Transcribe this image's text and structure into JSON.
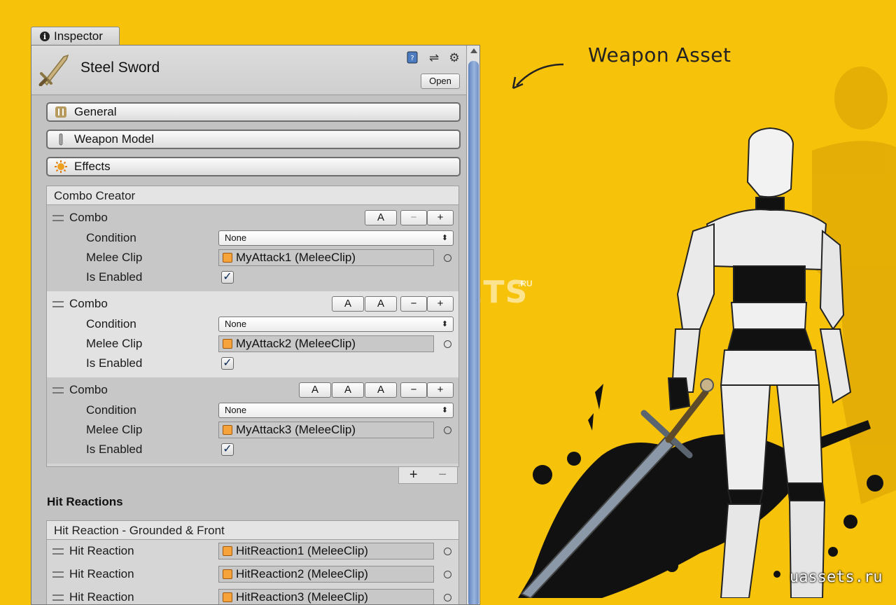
{
  "inspector": {
    "tab_label": "Inspector",
    "asset_title": "Steel Sword",
    "open_label": "Open",
    "sections": [
      {
        "label": "General",
        "icon": "general-icon"
      },
      {
        "label": "Weapon Model",
        "icon": "weapon-model-icon"
      },
      {
        "label": "Effects",
        "icon": "effects-icon"
      }
    ],
    "combo_creator": {
      "header": "Combo Creator",
      "combos": [
        {
          "label": "Combo",
          "buttons": [
            "A"
          ],
          "condition_label": "Condition",
          "condition_value": "None",
          "clip_label": "Melee Clip",
          "clip_value": "MyAttack1 (MeleeClip)",
          "enabled_label": "Is Enabled",
          "enabled": true
        },
        {
          "label": "Combo",
          "buttons": [
            "A",
            "A"
          ],
          "condition_label": "Condition",
          "condition_value": "None",
          "clip_label": "Melee Clip",
          "clip_value": "MyAttack2 (MeleeClip)",
          "enabled_label": "Is Enabled",
          "enabled": true
        },
        {
          "label": "Combo",
          "buttons": [
            "A",
            "A",
            "A"
          ],
          "condition_label": "Condition",
          "condition_value": "None",
          "clip_label": "Melee Clip",
          "clip_value": "MyAttack3 (MeleeClip)",
          "enabled_label": "Is Enabled",
          "enabled": true
        }
      ],
      "minus_label": "−",
      "plus_label": "+"
    },
    "hit_reactions": {
      "title": "Hit Reactions",
      "header": "Hit Reaction - Grounded & Front",
      "items": [
        {
          "label": "Hit Reaction",
          "value": "HitReaction1 (MeleeClip)"
        },
        {
          "label": "Hit Reaction",
          "value": "HitReaction2 (MeleeClip)"
        },
        {
          "label": "Hit Reaction",
          "value": "HitReaction3 (MeleeClip)"
        }
      ]
    }
  },
  "annotation": "Weapon Asset",
  "watermark": {
    "main": "U ASSETS",
    "suffix": ".RU"
  },
  "site": "uassets.ru",
  "colors": {
    "background": "#f7c20a",
    "scroll_thumb": "#7c9ccf"
  }
}
